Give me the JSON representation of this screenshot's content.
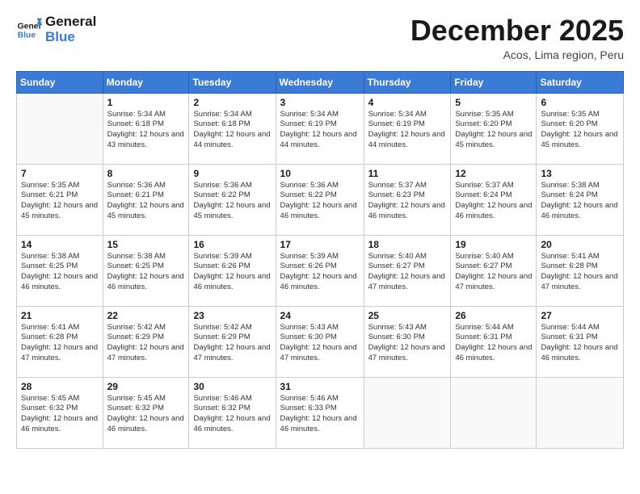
{
  "logo": {
    "line1": "General",
    "line2": "Blue"
  },
  "title": "December 2025",
  "subtitle": "Acos, Lima region, Peru",
  "weekdays": [
    "Sunday",
    "Monday",
    "Tuesday",
    "Wednesday",
    "Thursday",
    "Friday",
    "Saturday"
  ],
  "weeks": [
    [
      {
        "day": "",
        "sunrise": "",
        "sunset": "",
        "daylight": ""
      },
      {
        "day": "1",
        "sunrise": "5:34 AM",
        "sunset": "6:18 PM",
        "daylight": "12 hours and 43 minutes."
      },
      {
        "day": "2",
        "sunrise": "5:34 AM",
        "sunset": "6:18 PM",
        "daylight": "12 hours and 44 minutes."
      },
      {
        "day": "3",
        "sunrise": "5:34 AM",
        "sunset": "6:19 PM",
        "daylight": "12 hours and 44 minutes."
      },
      {
        "day": "4",
        "sunrise": "5:34 AM",
        "sunset": "6:19 PM",
        "daylight": "12 hours and 44 minutes."
      },
      {
        "day": "5",
        "sunrise": "5:35 AM",
        "sunset": "6:20 PM",
        "daylight": "12 hours and 45 minutes."
      },
      {
        "day": "6",
        "sunrise": "5:35 AM",
        "sunset": "6:20 PM",
        "daylight": "12 hours and 45 minutes."
      }
    ],
    [
      {
        "day": "7",
        "sunrise": "5:35 AM",
        "sunset": "6:21 PM",
        "daylight": "12 hours and 45 minutes."
      },
      {
        "day": "8",
        "sunrise": "5:36 AM",
        "sunset": "6:21 PM",
        "daylight": "12 hours and 45 minutes."
      },
      {
        "day": "9",
        "sunrise": "5:36 AM",
        "sunset": "6:22 PM",
        "daylight": "12 hours and 45 minutes."
      },
      {
        "day": "10",
        "sunrise": "5:36 AM",
        "sunset": "6:22 PM",
        "daylight": "12 hours and 46 minutes."
      },
      {
        "day": "11",
        "sunrise": "5:37 AM",
        "sunset": "6:23 PM",
        "daylight": "12 hours and 46 minutes."
      },
      {
        "day": "12",
        "sunrise": "5:37 AM",
        "sunset": "6:24 PM",
        "daylight": "12 hours and 46 minutes."
      },
      {
        "day": "13",
        "sunrise": "5:38 AM",
        "sunset": "6:24 PM",
        "daylight": "12 hours and 46 minutes."
      }
    ],
    [
      {
        "day": "14",
        "sunrise": "5:38 AM",
        "sunset": "6:25 PM",
        "daylight": "12 hours and 46 minutes."
      },
      {
        "day": "15",
        "sunrise": "5:38 AM",
        "sunset": "6:25 PM",
        "daylight": "12 hours and 46 minutes."
      },
      {
        "day": "16",
        "sunrise": "5:39 AM",
        "sunset": "6:26 PM",
        "daylight": "12 hours and 46 minutes."
      },
      {
        "day": "17",
        "sunrise": "5:39 AM",
        "sunset": "6:26 PM",
        "daylight": "12 hours and 46 minutes."
      },
      {
        "day": "18",
        "sunrise": "5:40 AM",
        "sunset": "6:27 PM",
        "daylight": "12 hours and 47 minutes."
      },
      {
        "day": "19",
        "sunrise": "5:40 AM",
        "sunset": "6:27 PM",
        "daylight": "12 hours and 47 minutes."
      },
      {
        "day": "20",
        "sunrise": "5:41 AM",
        "sunset": "6:28 PM",
        "daylight": "12 hours and 47 minutes."
      }
    ],
    [
      {
        "day": "21",
        "sunrise": "5:41 AM",
        "sunset": "6:28 PM",
        "daylight": "12 hours and 47 minutes."
      },
      {
        "day": "22",
        "sunrise": "5:42 AM",
        "sunset": "6:29 PM",
        "daylight": "12 hours and 47 minutes."
      },
      {
        "day": "23",
        "sunrise": "5:42 AM",
        "sunset": "6:29 PM",
        "daylight": "12 hours and 47 minutes."
      },
      {
        "day": "24",
        "sunrise": "5:43 AM",
        "sunset": "6:30 PM",
        "daylight": "12 hours and 47 minutes."
      },
      {
        "day": "25",
        "sunrise": "5:43 AM",
        "sunset": "6:30 PM",
        "daylight": "12 hours and 47 minutes."
      },
      {
        "day": "26",
        "sunrise": "5:44 AM",
        "sunset": "6:31 PM",
        "daylight": "12 hours and 46 minutes."
      },
      {
        "day": "27",
        "sunrise": "5:44 AM",
        "sunset": "6:31 PM",
        "daylight": "12 hours and 46 minutes."
      }
    ],
    [
      {
        "day": "28",
        "sunrise": "5:45 AM",
        "sunset": "6:32 PM",
        "daylight": "12 hours and 46 minutes."
      },
      {
        "day": "29",
        "sunrise": "5:45 AM",
        "sunset": "6:32 PM",
        "daylight": "12 hours and 46 minutes."
      },
      {
        "day": "30",
        "sunrise": "5:46 AM",
        "sunset": "6:32 PM",
        "daylight": "12 hours and 46 minutes."
      },
      {
        "day": "31",
        "sunrise": "5:46 AM",
        "sunset": "6:33 PM",
        "daylight": "12 hours and 46 minutes."
      },
      {
        "day": "",
        "sunrise": "",
        "sunset": "",
        "daylight": ""
      },
      {
        "day": "",
        "sunrise": "",
        "sunset": "",
        "daylight": ""
      },
      {
        "day": "",
        "sunrise": "",
        "sunset": "",
        "daylight": ""
      }
    ]
  ]
}
